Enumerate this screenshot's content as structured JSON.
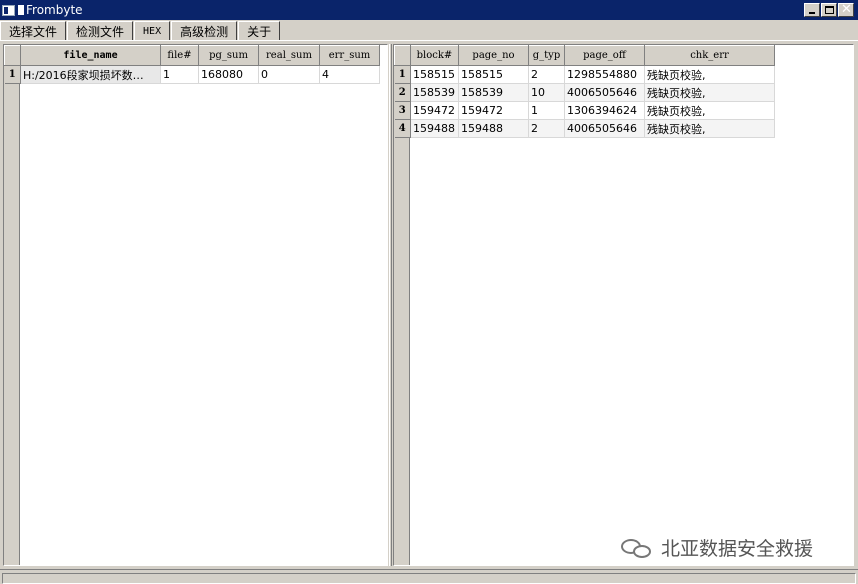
{
  "window": {
    "title": "Frombyte",
    "controls": {
      "minimize": "minimize-icon",
      "maximize": "maximize-icon",
      "close": "close-icon",
      "close_glyph": "✕"
    }
  },
  "tabs": [
    {
      "label": "选择文件"
    },
    {
      "label": "检测文件",
      "active": true
    },
    {
      "label": "HEX"
    },
    {
      "label": "高级检测"
    },
    {
      "label": "关于"
    }
  ],
  "left_table": {
    "columns": [
      "file_name",
      "file#",
      "pg_sum",
      "real_sum",
      "err_sum"
    ],
    "rows": [
      {
        "index": "1",
        "file_name": "H:/2016段家坝损坏数…",
        "file_no": "1",
        "pg_sum": "168080",
        "real_sum": "0",
        "err_sum": "4"
      }
    ]
  },
  "right_table": {
    "columns": [
      "block#",
      "page_no",
      "g_typ",
      "page_off",
      "chk_err"
    ],
    "rows": [
      {
        "index": "1",
        "block": "158515",
        "page_no": "158515",
        "g_typ": "2",
        "page_off": "1298554880",
        "chk_err": "残缺页校验,"
      },
      {
        "index": "2",
        "block": "158539",
        "page_no": "158539",
        "g_typ": "10",
        "page_off": "4006505646",
        "chk_err": "残缺页校验,"
      },
      {
        "index": "3",
        "block": "159472",
        "page_no": "159472",
        "g_typ": "1",
        "page_off": "1306394624",
        "chk_err": "残缺页校验,"
      },
      {
        "index": "4",
        "block": "159488",
        "page_no": "159488",
        "g_typ": "2",
        "page_off": "4006505646",
        "chk_err": "残缺页校验,"
      }
    ]
  },
  "watermark": {
    "text": "北亚数据安全救援",
    "icon": "wechat-icon"
  },
  "colors": {
    "titlebar": "#0a246a",
    "chrome": "#d4d0c8"
  }
}
